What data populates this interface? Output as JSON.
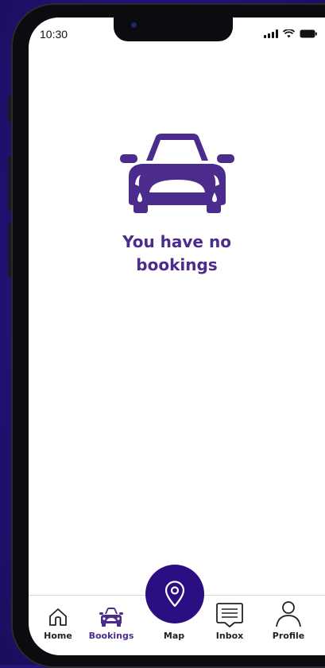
{
  "status_bar": {
    "time": "10:30"
  },
  "empty_state": {
    "message": "You have no bookings"
  },
  "map_button": {
    "icon": "map-pin-icon"
  },
  "tabs": [
    {
      "label": "Home",
      "icon": "home-icon",
      "active": false
    },
    {
      "label": "Bookings",
      "icon": "car-icon",
      "active": true
    },
    {
      "label": "Map",
      "icon": "map-pin-icon",
      "active": false
    },
    {
      "label": "Inbox",
      "icon": "inbox-icon",
      "active": false
    },
    {
      "label": "Profile",
      "icon": "profile-icon",
      "active": false
    }
  ],
  "colors": {
    "primary": "#2b0e82",
    "text_accent": "#4b2c8c",
    "background": "#24157a"
  }
}
